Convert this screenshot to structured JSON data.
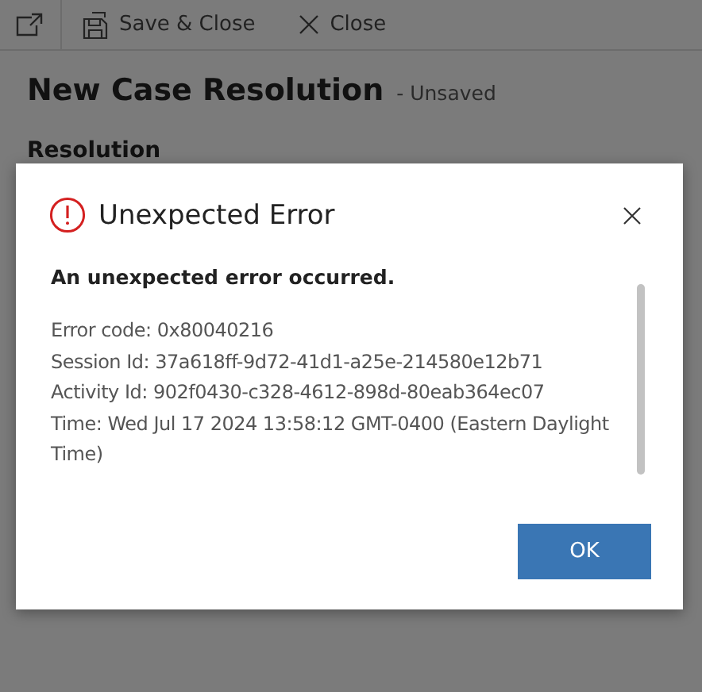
{
  "toolbar": {
    "buttons": [
      {
        "label": "Save & Close",
        "kind": "save"
      },
      {
        "label": "Close",
        "kind": "close"
      }
    ]
  },
  "form": {
    "title": "New Case Resolution",
    "status": "- Unsaved",
    "section": "Resolution"
  },
  "dialog": {
    "title": "Unexpected Error",
    "heading": "An unexpected error occurred.",
    "lines": [
      "Error code: 0x80040216",
      "Session Id: 37a618ff-9d72-41d1-a25e-214580e12b71",
      "Activity Id: 902f0430-c328-4612-898d-80eab364ec07",
      "Time: Wed Jul 17 2024 13:58:12 GMT-0400 (Eastern Daylight Time)"
    ],
    "ok_button": "OK"
  }
}
